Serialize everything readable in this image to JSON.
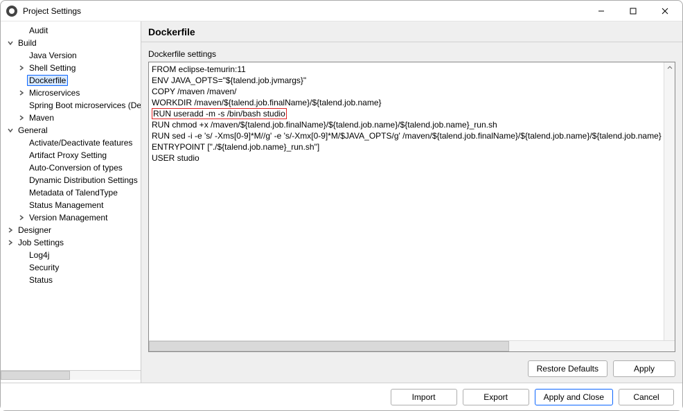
{
  "window": {
    "title": "Project Settings"
  },
  "sidebar": {
    "items": [
      {
        "label": "Audit",
        "level": 1,
        "twisty": "none"
      },
      {
        "label": "Build",
        "level": 0,
        "twisty": "open"
      },
      {
        "label": "Java Version",
        "level": 2,
        "twisty": "none"
      },
      {
        "label": "Shell Setting",
        "level": 1,
        "twisty": "closed"
      },
      {
        "label": "Dockerfile",
        "level": 2,
        "twisty": "none",
        "selected": true
      },
      {
        "label": "Microservices",
        "level": 1,
        "twisty": "closed"
      },
      {
        "label": "Spring Boot microservices (Deprecated)",
        "level": 2,
        "twisty": "none"
      },
      {
        "label": "Maven",
        "level": 1,
        "twisty": "closed"
      },
      {
        "label": "General",
        "level": 0,
        "twisty": "open"
      },
      {
        "label": "Activate/Deactivate features",
        "level": 2,
        "twisty": "none"
      },
      {
        "label": "Artifact Proxy Setting",
        "level": 2,
        "twisty": "none"
      },
      {
        "label": "Auto-Conversion of types",
        "level": 2,
        "twisty": "none"
      },
      {
        "label": "Dynamic Distribution Settings",
        "level": 2,
        "twisty": "none"
      },
      {
        "label": "Metadata of TalendType",
        "level": 2,
        "twisty": "none"
      },
      {
        "label": "Status Management",
        "level": 2,
        "twisty": "none"
      },
      {
        "label": "Version Management",
        "level": 1,
        "twisty": "closed"
      },
      {
        "label": "Designer",
        "level": 0,
        "twisty": "closed"
      },
      {
        "label": "Job Settings",
        "level": 0,
        "twisty": "closed"
      },
      {
        "label": "Log4j",
        "level": 1,
        "twisty": "none"
      },
      {
        "label": "Security",
        "level": 1,
        "twisty": "none"
      },
      {
        "label": "Status",
        "level": 1,
        "twisty": "none"
      }
    ]
  },
  "main": {
    "heading": "Dockerfile",
    "panel_label": "Dockerfile settings",
    "editor_lines": [
      "FROM eclipse-temurin:11",
      "ENV JAVA_OPTS=\"${talend.job.jvmargs}\"",
      "COPY /maven /maven/",
      "WORKDIR /maven/${talend.job.finalName}/${talend.job.name}",
      "RUN useradd -m -s /bin/bash studio",
      "RUN chmod +x /maven/${talend.job.finalName}/${talend.job.name}/${talend.job.name}_run.sh",
      "RUN sed -i -e 's/ -Xms[0-9]*M//g' -e 's/-Xmx[0-9]*M/$JAVA_OPTS/g' /maven/${talend.job.finalName}/${talend.job.name}/${talend.job.name}",
      "ENTRYPOINT [\"./${talend.job.name}_run.sh\"]",
      "USER studio"
    ],
    "highlight_line_index": 4
  },
  "buttons": {
    "restore_defaults": "Restore Defaults",
    "apply": "Apply",
    "import": "Import",
    "export": "Export",
    "apply_close": "Apply and Close",
    "cancel": "Cancel"
  }
}
